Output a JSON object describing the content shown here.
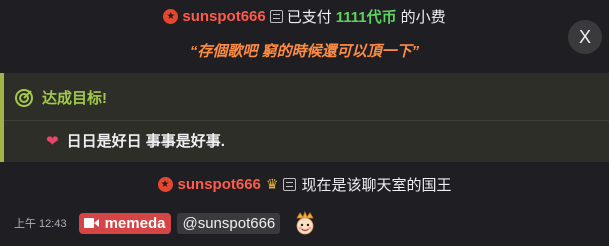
{
  "tip": {
    "username": "sunspot666",
    "prefix": "已支付",
    "amount": "1111代币",
    "suffix": "的小费",
    "message": "“存個歌吧 窮的時候還可以頂一下”"
  },
  "close_button": {
    "label": "X"
  },
  "goal": {
    "title": "达成目标!",
    "text": "日日是好日 事事是好事."
  },
  "king": {
    "username": "sunspot666",
    "text": "现在是该聊天室的国王"
  },
  "chat": {
    "timestamp": "上午 12:43",
    "sender": "memeda",
    "mention": "@sunspot666"
  },
  "colors": {
    "accent_red": "#ff5a4a",
    "amount_green": "#5fd35f",
    "message_orange": "#ff8c42",
    "goal_green": "#a3c94a",
    "badge_red": "#d64545"
  },
  "icons": [
    "star-icon",
    "document-icon",
    "x-icon",
    "target-icon",
    "heart-icon",
    "crown-icon",
    "camera-icon",
    "king-emote"
  ]
}
